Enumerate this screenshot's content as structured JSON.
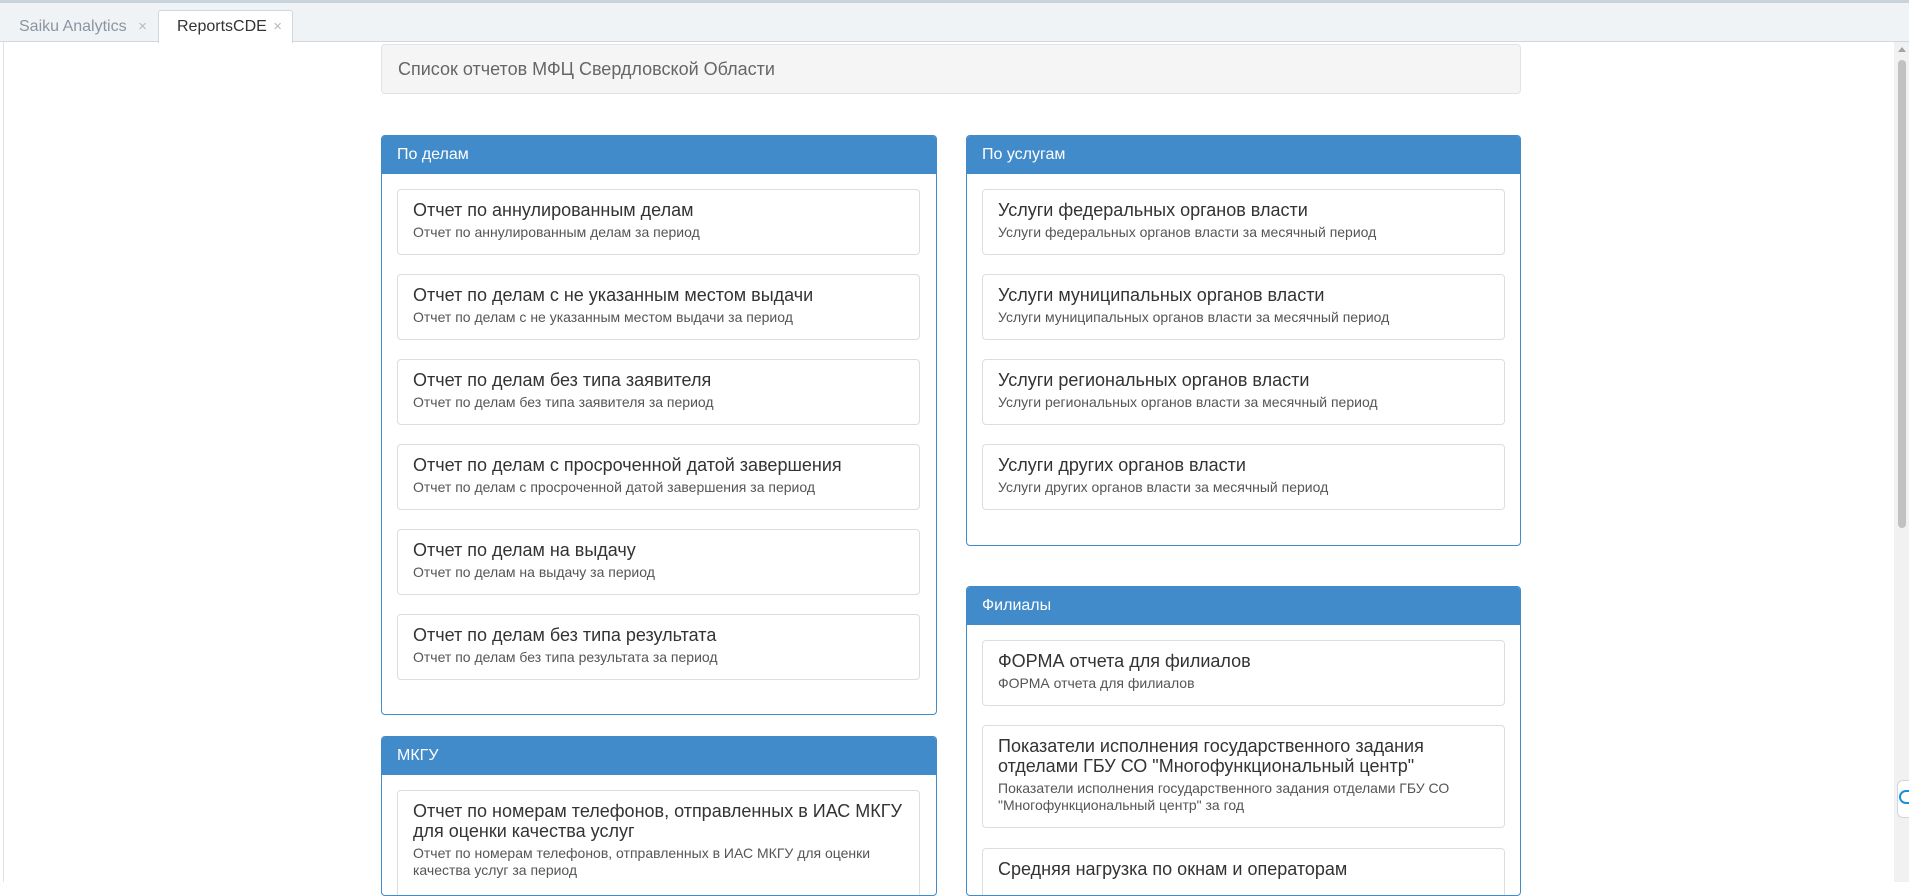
{
  "tabs": [
    {
      "label": "Saiku Analytics",
      "close": "×"
    },
    {
      "label": "ReportsCDE",
      "close": "×"
    }
  ],
  "header": {
    "title": "Список отчетов МФЦ Свердловской Области"
  },
  "panels": {
    "cases": {
      "heading": "По делам",
      "items": [
        {
          "title": "Отчет по аннулированным делам",
          "desc": "Отчет по аннулированным делам за период"
        },
        {
          "title": "Отчет по делам с не указанным местом выдачи",
          "desc": "Отчет по делам с не указанным местом выдачи за период"
        },
        {
          "title": "Отчет по делам без типа заявителя",
          "desc": "Отчет по делам без типа заявителя за период"
        },
        {
          "title": "Отчет по делам с просроченной датой завершения",
          "desc": "Отчет по делам с просроченной датой завершения за период"
        },
        {
          "title": "Отчет по делам на выдачу",
          "desc": "Отчет по делам на выдачу за период"
        },
        {
          "title": "Отчет по делам без типа результата",
          "desc": "Отчет по делам без типа результата за период"
        }
      ]
    },
    "services": {
      "heading": "По услугам",
      "items": [
        {
          "title": "Услуги федеральных органов власти",
          "desc": "Услуги федеральных органов власти за месячный период"
        },
        {
          "title": "Услуги муниципальных органов власти",
          "desc": "Услуги муниципальных органов власти за месячный период"
        },
        {
          "title": "Услуги региональных органов власти",
          "desc": "Услуги региональных органов власти за месячный период"
        },
        {
          "title": "Услуги других органов власти",
          "desc": "Услуги других органов власти за месячный период"
        }
      ]
    },
    "mkgu": {
      "heading": "МКГУ",
      "items": [
        {
          "title": "Отчет по номерам телефонов, отправленных в ИАС МКГУ для оценки качества услуг",
          "desc": "Отчет по номерам телефонов, отправленных в ИАС МКГУ для оценки качества услуг за период"
        }
      ]
    },
    "branches": {
      "heading": "Филиалы",
      "items": [
        {
          "title": "ФОРМА отчета для филиалов",
          "desc": "ФОРМА отчета для филиалов"
        },
        {
          "title": "Показатели исполнения государственного задания отделами ГБУ СО \"Многофункциональный центр\"",
          "desc": "Показатели исполнения государственного задания отделами ГБУ СО \"Многофункциональный центр\" за год"
        },
        {
          "title": "Средняя нагрузка по окнам и операторам",
          "desc": ""
        }
      ]
    }
  }
}
